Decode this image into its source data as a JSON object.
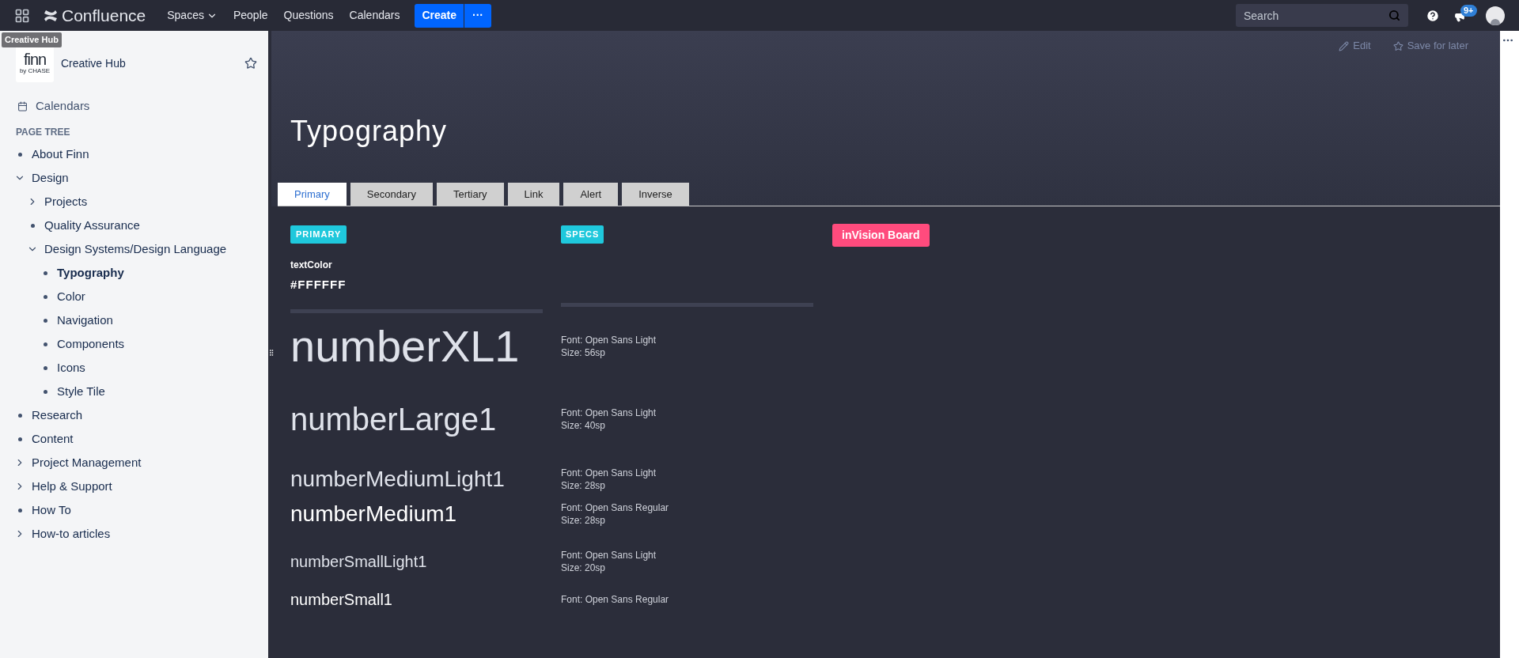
{
  "top_nav": {
    "logo_text": "Confluence",
    "menu": [
      {
        "label": "Spaces",
        "dropdown": true
      },
      {
        "label": "People",
        "dropdown": false
      },
      {
        "label": "Questions",
        "dropdown": false
      },
      {
        "label": "Calendars",
        "dropdown": false
      }
    ],
    "create_button": "Create",
    "more_button": "···",
    "search": {
      "placeholder": "Search"
    },
    "notifications_badge": "9+"
  },
  "tooltip": "Creative Hub",
  "sidebar": {
    "space_logo": {
      "wordmark": "finn",
      "tagline": "by CHASE"
    },
    "space_name": "Creative Hub",
    "starred": false,
    "shortcuts": [
      {
        "label": "Calendars"
      }
    ],
    "page_tree_heading": "PAGE TREE",
    "tree": [
      {
        "label": "About Finn",
        "selected": false
      },
      {
        "label": "Design",
        "selected": false,
        "expanded": true,
        "children": [
          {
            "label": "Projects",
            "selected": false,
            "expanded": false
          },
          {
            "label": "Quality Assurance",
            "selected": false
          },
          {
            "label": "Design Systems/Design Language",
            "selected": false,
            "expanded": true,
            "children": [
              {
                "label": "Typography",
                "selected": true
              },
              {
                "label": "Color",
                "selected": false
              },
              {
                "label": "Navigation",
                "selected": false
              },
              {
                "label": "Components",
                "selected": false
              },
              {
                "label": "Icons",
                "selected": false
              },
              {
                "label": "Style Tile",
                "selected": false
              }
            ]
          }
        ]
      },
      {
        "label": "Research",
        "selected": false
      },
      {
        "label": "Content",
        "selected": false
      },
      {
        "label": "Project Management",
        "selected": false,
        "expanded": false
      },
      {
        "label": "Help & Support",
        "selected": false,
        "expanded": false
      },
      {
        "label": "How To",
        "selected": false
      },
      {
        "label": "How-to articles",
        "selected": false,
        "expanded": false
      }
    ]
  },
  "page": {
    "actions": [
      {
        "label": "Edit",
        "kind": "edit"
      },
      {
        "label": "Save for later",
        "kind": "save"
      }
    ],
    "title": "Typography",
    "tabs": [
      {
        "label": "Primary",
        "selected": true
      },
      {
        "label": "Secondary",
        "selected": false
      },
      {
        "label": "Tertiary",
        "selected": false
      },
      {
        "label": "Link",
        "selected": false
      },
      {
        "label": "Alert",
        "selected": false
      },
      {
        "label": "Inverse",
        "selected": false
      }
    ],
    "primary_badge": "PRIMARY",
    "specs_badge": "SPECS",
    "invision_button": "inVision Board",
    "token_label": "textColor",
    "token_value": "#FFFFFF",
    "specimen_groups": [
      {
        "specimens": [
          {
            "name": "numberXL1",
            "kind": "xl",
            "light": true,
            "font": "Font: Open Sans Light",
            "size": "Size: 56sp"
          }
        ]
      },
      {
        "specimens": [
          {
            "name": "numberLarge1",
            "kind": "large",
            "light": true,
            "font": "Font: Open Sans Light",
            "size": "Size: 40sp"
          }
        ]
      },
      {
        "specimens": [
          {
            "name": "numberMediumLight1",
            "kind": "medium",
            "light": true,
            "font": "Font: Open Sans Light",
            "size": "Size: 28sp"
          },
          {
            "name": "numberMedium1",
            "kind": "medium",
            "light": false,
            "font": "Font: Open Sans Regular",
            "size": "Size: 28sp"
          }
        ]
      },
      {
        "specimens": [
          {
            "name": "numberSmallLight1",
            "kind": "small",
            "light": true,
            "font": "Font: Open Sans Light",
            "size": "Size: 20sp"
          },
          {
            "name": "numberSmall1",
            "kind": "small",
            "light": false,
            "font": "Font: Open Sans Regular"
          }
        ]
      }
    ]
  }
}
